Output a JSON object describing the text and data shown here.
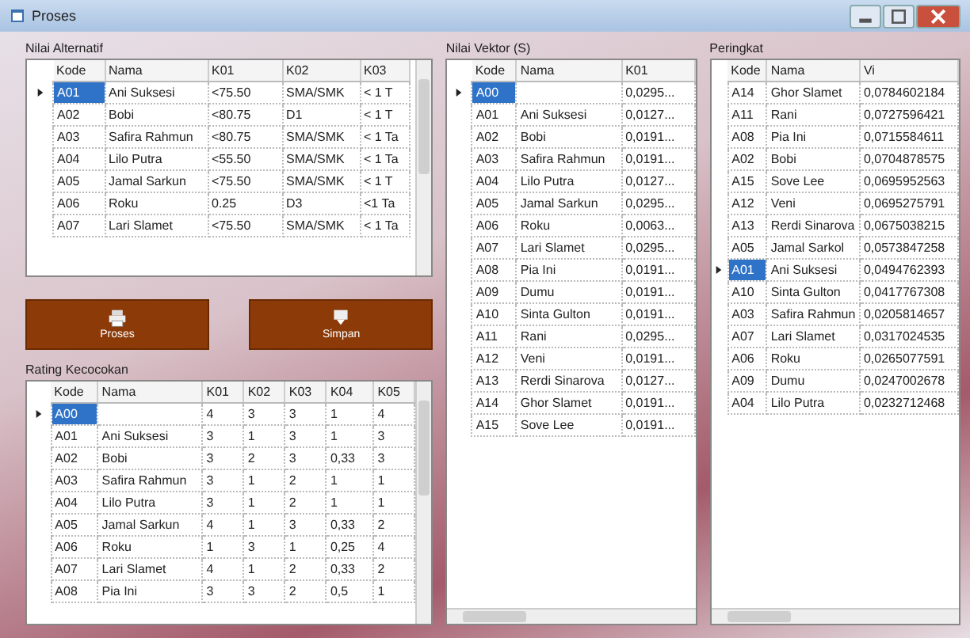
{
  "window": {
    "title": "Proses"
  },
  "alternatives": {
    "label": "Nilai Alternatif",
    "columns": [
      "Kode",
      "Nama",
      "K01",
      "K02",
      "K03"
    ],
    "rows": [
      {
        "selected": true,
        "cells": [
          "A01",
          "Ani Suksesi",
          "<75.50",
          "SMA/SMK",
          "< 1 T"
        ]
      },
      {
        "selected": false,
        "cells": [
          "A02",
          "Bobi",
          "<80.75",
          "D1",
          "< 1 T"
        ]
      },
      {
        "selected": false,
        "cells": [
          "A03",
          "Safira Rahmun",
          "<80.75",
          "SMA/SMK",
          "< 1 Ta"
        ]
      },
      {
        "selected": false,
        "cells": [
          "A04",
          "Lilo Putra",
          "<55.50",
          "SMA/SMK",
          "< 1 Ta"
        ]
      },
      {
        "selected": false,
        "cells": [
          "A05",
          "Jamal Sarkun",
          "<75.50",
          "SMA/SMK",
          "< 1 T"
        ]
      },
      {
        "selected": false,
        "cells": [
          "A06",
          "Roku",
          "0.25",
          "D3",
          "<1 Ta"
        ]
      },
      {
        "selected": false,
        "cells": [
          "A07",
          "Lari Slamet",
          "<75.50",
          "SMA/SMK",
          "< 1 Ta"
        ]
      }
    ]
  },
  "buttons": [
    {
      "label": "Proses",
      "kind": "print"
    },
    {
      "label": "Simpan",
      "kind": "download"
    }
  ],
  "ratings": {
    "label": "Rating Kecocokan",
    "columns": [
      "Kode",
      "Nama",
      "K01",
      "K02",
      "K03",
      "K04",
      "K05"
    ],
    "rows": [
      {
        "selected": true,
        "cells": [
          "A00",
          "",
          "4",
          "3",
          "3",
          "1",
          "4"
        ]
      },
      {
        "selected": false,
        "cells": [
          "A01",
          "Ani Suksesi",
          "3",
          "1",
          "3",
          "1",
          "3"
        ]
      },
      {
        "selected": false,
        "cells": [
          "A02",
          "Bobi",
          "3",
          "2",
          "3",
          "0,33",
          "3"
        ]
      },
      {
        "selected": false,
        "cells": [
          "A03",
          "Safira Rahmun",
          "3",
          "1",
          "2",
          "1",
          "1"
        ]
      },
      {
        "selected": false,
        "cells": [
          "A04",
          "Lilo Putra",
          "3",
          "1",
          "2",
          "1",
          "1"
        ]
      },
      {
        "selected": false,
        "cells": [
          "A05",
          "Jamal Sarkun",
          "4",
          "1",
          "3",
          "0,33",
          "2"
        ]
      },
      {
        "selected": false,
        "cells": [
          "A06",
          "Roku",
          "1",
          "3",
          "1",
          "0,25",
          "4"
        ]
      },
      {
        "selected": false,
        "cells": [
          "A07",
          "Lari Slamet",
          "4",
          "1",
          "2",
          "0,33",
          "2"
        ]
      },
      {
        "selected": false,
        "cells": [
          "A08",
          "Pia Ini",
          "3",
          "3",
          "2",
          "0,5",
          "1"
        ]
      }
    ]
  },
  "vectors": {
    "label": "Nilai Vektor (S)",
    "columns": [
      "Kode",
      "Nama",
      "K01"
    ],
    "rows": [
      {
        "selected": true,
        "cells": [
          "A00",
          "",
          "0,0295..."
        ]
      },
      {
        "selected": false,
        "cells": [
          "A01",
          "Ani Suksesi",
          "0,0127..."
        ]
      },
      {
        "selected": false,
        "cells": [
          "A02",
          "Bobi",
          "0,0191..."
        ]
      },
      {
        "selected": false,
        "cells": [
          "A03",
          "Safira Rahmun",
          "0,0191..."
        ]
      },
      {
        "selected": false,
        "cells": [
          "A04",
          "Lilo Putra",
          "0,0127..."
        ]
      },
      {
        "selected": false,
        "cells": [
          "A05",
          "Jamal Sarkun",
          "0,0295..."
        ]
      },
      {
        "selected": false,
        "cells": [
          "A06",
          "Roku",
          "0,0063..."
        ]
      },
      {
        "selected": false,
        "cells": [
          "A07",
          "Lari Slamet",
          "0,0295..."
        ]
      },
      {
        "selected": false,
        "cells": [
          "A08",
          "Pia Ini",
          "0,0191..."
        ]
      },
      {
        "selected": false,
        "cells": [
          "A09",
          "Dumu",
          "0,0191..."
        ]
      },
      {
        "selected": false,
        "cells": [
          "A10",
          "Sinta Gulton",
          "0,0191..."
        ]
      },
      {
        "selected": false,
        "cells": [
          "A11",
          "Rani",
          "0,0295..."
        ]
      },
      {
        "selected": false,
        "cells": [
          "A12",
          "Veni",
          "0,0191..."
        ]
      },
      {
        "selected": false,
        "cells": [
          "A13",
          "Rerdi Sinarova",
          "0,0127..."
        ]
      },
      {
        "selected": false,
        "cells": [
          "A14",
          "Ghor Slamet",
          "0,0191..."
        ]
      },
      {
        "selected": false,
        "cells": [
          "A15",
          "Sove Lee",
          "0,0191..."
        ]
      }
    ]
  },
  "results": {
    "label": "Peringkat",
    "columns": [
      "Kode",
      "Nama",
      "Vi"
    ],
    "rows": [
      {
        "selected": false,
        "cells": [
          "A14",
          "Ghor Slamet",
          "0,0784602184"
        ]
      },
      {
        "selected": false,
        "cells": [
          "A11",
          "Rani",
          "0,0727596421"
        ]
      },
      {
        "selected": false,
        "cells": [
          "A08",
          "Pia Ini",
          "0,0715584611"
        ]
      },
      {
        "selected": false,
        "cells": [
          "A02",
          "Bobi",
          "0,0704878575"
        ]
      },
      {
        "selected": false,
        "cells": [
          "A15",
          "Sove Lee",
          "0,0695952563"
        ]
      },
      {
        "selected": false,
        "cells": [
          "A12",
          "Veni",
          "0,0695275791"
        ]
      },
      {
        "selected": false,
        "cells": [
          "A13",
          "Rerdi Sinarova",
          "0,0675038215"
        ]
      },
      {
        "selected": false,
        "cells": [
          "A05",
          "Jamal Sarkol",
          "0,0573847258"
        ]
      },
      {
        "selected": true,
        "cells": [
          "A01",
          "Ani Suksesi",
          "0,0494762393"
        ]
      },
      {
        "selected": false,
        "cells": [
          "A10",
          "Sinta Gulton",
          "0,0417767308"
        ]
      },
      {
        "selected": false,
        "cells": [
          "A03",
          "Safira Rahmun",
          "0,0205814657"
        ]
      },
      {
        "selected": false,
        "cells": [
          "A07",
          "Lari Slamet",
          "0,0317024535"
        ]
      },
      {
        "selected": false,
        "cells": [
          "A06",
          "Roku",
          "0,0265077591"
        ]
      },
      {
        "selected": false,
        "cells": [
          "A09",
          "Dumu",
          "0,0247002678"
        ]
      },
      {
        "selected": false,
        "cells": [
          "A04",
          "Lilo Putra",
          "0,0232712468"
        ]
      }
    ]
  }
}
